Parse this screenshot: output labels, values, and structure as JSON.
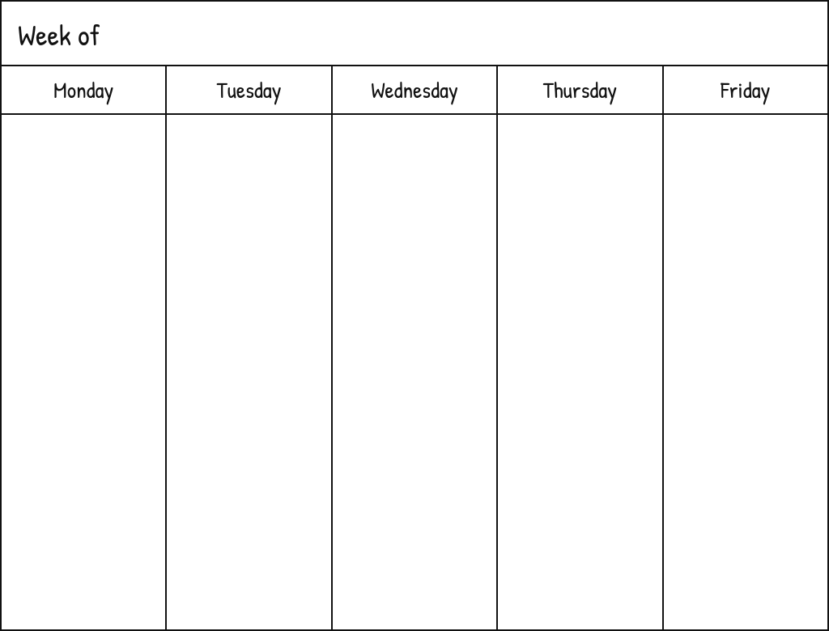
{
  "header": {
    "title": "Week of"
  },
  "days": [
    {
      "label": "Monday"
    },
    {
      "label": "Tuesday"
    },
    {
      "label": "Wednesday"
    },
    {
      "label": "Thursday"
    },
    {
      "label": "Friday"
    }
  ]
}
